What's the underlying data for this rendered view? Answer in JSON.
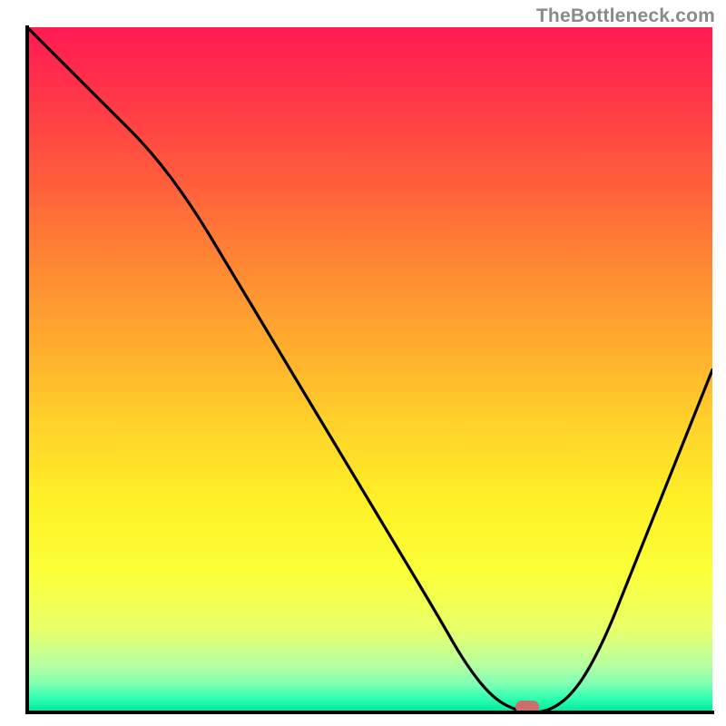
{
  "watermark": "TheBottleneck.com",
  "chart_data": {
    "type": "line",
    "title": "",
    "xlabel": "",
    "ylabel": "",
    "xlim": [
      0,
      100
    ],
    "ylim": [
      0,
      100
    ],
    "grid": false,
    "series": [
      {
        "name": "bottleneck-curve",
        "x": [
          0,
          6,
          12,
          18,
          24,
          30,
          36,
          42,
          48,
          54,
          60,
          64,
          68,
          72,
          76,
          80,
          84,
          88,
          92,
          96,
          100
        ],
        "values": [
          100,
          94,
          88,
          82,
          74,
          64,
          54,
          44,
          34,
          24,
          14,
          7,
          2,
          0,
          0,
          3,
          10,
          20,
          30,
          40,
          50
        ]
      }
    ],
    "marker": {
      "x": 73,
      "y": 0.8,
      "label": "optimal-point"
    },
    "gradient_stops": [
      {
        "pos": 0.0,
        "color": "#ff1a52"
      },
      {
        "pos": 0.1,
        "color": "#ff3648"
      },
      {
        "pos": 0.22,
        "color": "#ff5c3c"
      },
      {
        "pos": 0.34,
        "color": "#ff8534"
      },
      {
        "pos": 0.46,
        "color": "#ffab2e"
      },
      {
        "pos": 0.58,
        "color": "#ffd22a"
      },
      {
        "pos": 0.7,
        "color": "#fff227"
      },
      {
        "pos": 0.8,
        "color": "#f9ff3a"
      },
      {
        "pos": 0.88,
        "color": "#e8ff6a"
      },
      {
        "pos": 0.93,
        "color": "#b8ffa0"
      },
      {
        "pos": 0.96,
        "color": "#7cffb4"
      },
      {
        "pos": 0.98,
        "color": "#2cffb0"
      },
      {
        "pos": 1.0,
        "color": "#00e89a"
      }
    ]
  }
}
